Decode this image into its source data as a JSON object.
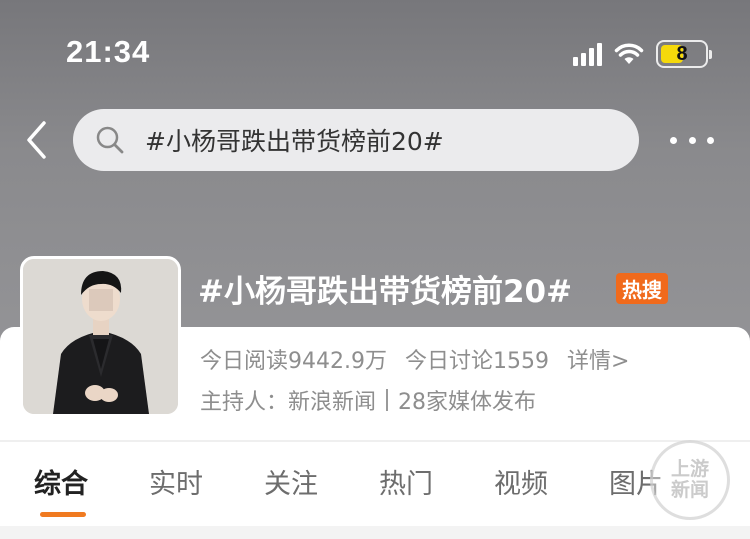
{
  "status_bar": {
    "time": "21:34",
    "battery_level": "8",
    "icons": [
      "cellular-signal-icon",
      "wifi-icon",
      "battery-icon"
    ]
  },
  "nav": {
    "back_icon": "chevron-left-icon",
    "search_icon": "search-icon",
    "search_value": "#小杨哥跌出带货榜前20#",
    "more_icon": "more-dots-icon"
  },
  "topic": {
    "title": "#小杨哥跌出带货榜前20#",
    "hot_badge": "热搜",
    "reads": "今日阅读9442.9万",
    "discussions": "今日讨论1559",
    "detail_link": "详情>",
    "host_label": "主持人：新浪新闻",
    "media_count": "28家媒体发布"
  },
  "tabs": [
    {
      "label": "综合",
      "active": true
    },
    {
      "label": "实时",
      "active": false
    },
    {
      "label": "关注",
      "active": false
    },
    {
      "label": "热门",
      "active": false
    },
    {
      "label": "视频",
      "active": false
    },
    {
      "label": "图片",
      "active": false
    }
  ],
  "watermark": {
    "line1": "上游",
    "line2": "新闻"
  },
  "colors": {
    "accent": "#f07a20",
    "hot_badge": "#f06a1c",
    "battery": "#f5d90b",
    "header_bg": "#87878a"
  }
}
